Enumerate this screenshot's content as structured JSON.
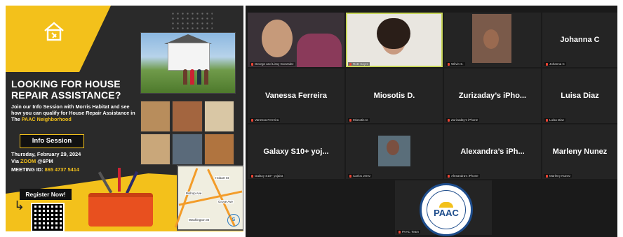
{
  "flyer": {
    "heading": "LOOKING FOR HOUSE REPAIR ASSISTANCE?",
    "description_line1": "Join our Info Session with Morris Habitat and see how you can qualify for House Repair Assistance in The",
    "description_highlight": "PAAC Neighborhood",
    "badge": "Info Session",
    "date": "Thursday, February 29, 2024",
    "via_label": "Via",
    "via_platform": "ZOOM",
    "time": "@6PM",
    "meeting_label": "MEETING ID:",
    "meeting_id": "865 4737 5414",
    "register_label": "Register Now!",
    "map_labels": [
      "Bishop Ave",
      "Hobart St",
      "Grove Ave",
      "Washington St"
    ]
  },
  "participants": [
    {
      "label": "George and Lissy Gonzalez"
    },
    {
      "label": "RoD Sayre"
    },
    {
      "label": "Wilvin S."
    },
    {
      "name": "Johanna C",
      "label": "Johanna C"
    },
    {
      "name": "Vanessa Ferreira",
      "label": "Vanessa Ferreira"
    },
    {
      "name": "Miosotis D.",
      "label": "Miosotis D."
    },
    {
      "name": "Zurizaday’s iPho...",
      "label": "Zurizaday's iPhone"
    },
    {
      "name": "Luisa Diaz",
      "label": "Luisa Diaz"
    },
    {
      "name": "Galaxy S10+ yoj...",
      "label": "Galaxy S10+ yojaira"
    },
    {
      "label": "Carlos Jerez"
    },
    {
      "name": "Alexandra’s iPh...",
      "label": "Alexandra's iPhone"
    },
    {
      "name": "Marleny Nunez",
      "label": "Marleny Nunez"
    },
    {
      "logo_text": "PAAC",
      "label": "PAAC Team"
    }
  ],
  "colors": {
    "flyer_yellow": "#f3c11b",
    "active_speaker": "#c8d65a",
    "tile_bg": "#242424"
  }
}
